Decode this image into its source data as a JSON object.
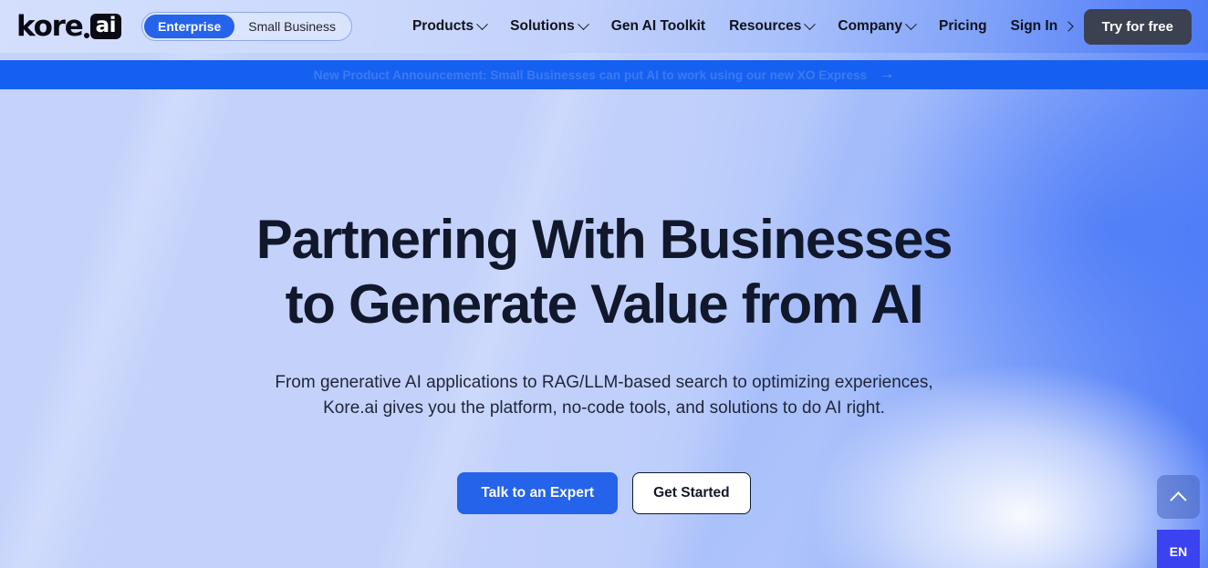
{
  "header": {
    "logo": {
      "wordmark": "kore",
      "suffix": "ai",
      "icon": "kore-ai-logo"
    },
    "segmented_toggle": {
      "options": [
        {
          "label": "Enterprise",
          "active": true
        },
        {
          "label": "Small Business",
          "active": false
        }
      ]
    },
    "nav_items": [
      {
        "label": "Products",
        "has_dropdown": true
      },
      {
        "label": "Solutions",
        "has_dropdown": true
      },
      {
        "label": "Gen AI Toolkit",
        "has_dropdown": false
      },
      {
        "label": "Resources",
        "has_dropdown": true
      },
      {
        "label": "Company",
        "has_dropdown": true
      },
      {
        "label": "Pricing",
        "has_dropdown": false
      },
      {
        "label": "Sign In",
        "has_dropdown": false,
        "has_chevron_right": true
      }
    ],
    "cta_label": "Try for free"
  },
  "banner": {
    "text": "New Product Announcement: Small Businesses can put AI to work using our new XO Express",
    "arrow": "→"
  },
  "hero": {
    "headline_line1": "Partnering With Businesses",
    "headline_line2": "to Generate Value from AI",
    "subhead_line1": "From generative AI applications to RAG/LLM-based search to optimizing experiences,",
    "subhead_line2": "Kore.ai gives you the platform, no-code tools, and solutions to do AI right.",
    "primary_cta": "Talk to an Expert",
    "secondary_cta": "Get Started"
  },
  "widgets": {
    "scroll_top_icon": "chevron-up-icon",
    "language_label": "EN"
  },
  "colors": {
    "accent_blue": "#2563eb",
    "banner_blue": "#1560f0",
    "dark_button": "#3b4150",
    "language_indigo": "#3b42f0",
    "hero_light": "#c5d3fb",
    "hero_deep": "#4f7bf6",
    "text_dark": "#11182b"
  }
}
